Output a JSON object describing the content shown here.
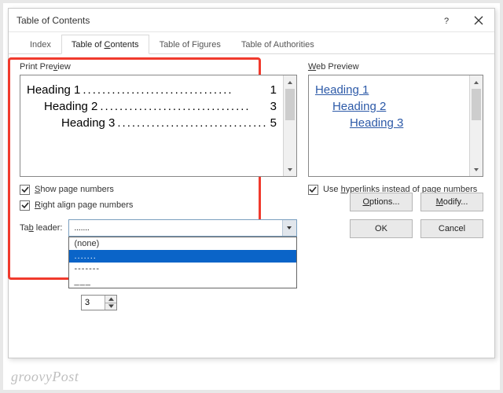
{
  "window": {
    "title": "Table of Contents"
  },
  "tabs": {
    "index": "Index",
    "toc_pre": "Table of ",
    "toc_key": "C",
    "toc_post": "ontents",
    "figures": "Table of Figures",
    "authorities": "Table of Authorities"
  },
  "print": {
    "title_pre": "Print Pre",
    "title_key": "v",
    "title_post": "iew",
    "rows": [
      {
        "label": "Heading 1",
        "page": "1",
        "indent": 0
      },
      {
        "label": "Heading 2",
        "page": "3",
        "indent": 1
      },
      {
        "label": "Heading 3",
        "page": "5",
        "indent": 2
      }
    ],
    "dots": "..............................."
  },
  "web": {
    "title_pre": "",
    "title_key": "W",
    "title_post": "eb Preview",
    "rows": [
      "Heading 1",
      "Heading 2",
      "Heading 3"
    ]
  },
  "checks": {
    "show_key": "S",
    "show_post": "how page numbers",
    "right_key": "R",
    "right_post": "ight align page numbers",
    "hyper_pre": "Use ",
    "hyper_key": "h",
    "hyper_post": "yperlinks instead of page numbers"
  },
  "tableader": {
    "label_pre": "Ta",
    "label_key": "b",
    "label_post": " leader:",
    "value": ".......",
    "options": {
      "none": "(none)",
      "dots": ".......",
      "dashes": "-------",
      "underline": "___"
    }
  },
  "levels": {
    "value": "3"
  },
  "buttons": {
    "options_key": "O",
    "options_post": "ptions...",
    "modify_key": "M",
    "modify_post": "odify...",
    "ok": "OK",
    "cancel": "Cancel"
  },
  "watermark": "groovyPost"
}
